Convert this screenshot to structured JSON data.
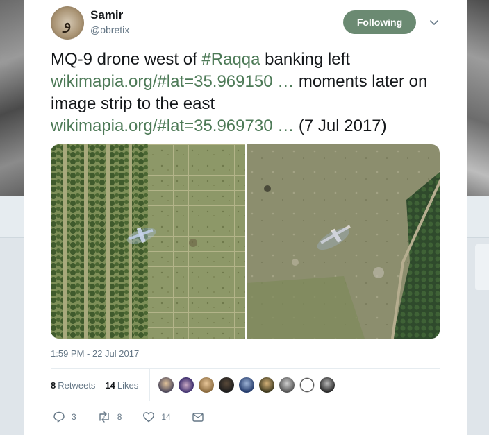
{
  "user": {
    "name": "Samir",
    "handle": "@obretix",
    "avatar_glyph": "و"
  },
  "follow_button": {
    "label": "Following"
  },
  "tweet": {
    "line1_pre": "MQ-9 drone west of ",
    "hashtag": "#Raqqa",
    "line1_post": " banking left",
    "link1": "wikimapia.org/#lat=35.969150 …",
    "mid_text": " moments later on image strip to the east",
    "link2": "wikimapia.org/#lat=35.969730 …",
    "tail_text": " (7 Jul 2017)"
  },
  "timestamp": "1:59 PM - 22 Jul 2017",
  "stats": {
    "retweets_count": "8",
    "retweets_label": "Retweets",
    "likes_count": "14",
    "likes_label": "Likes"
  },
  "actions": {
    "reply_count": "3",
    "retweet_count": "8",
    "like_count": "14"
  },
  "colors": {
    "accent": "#4d7a57",
    "follow_bg": "#6b8a72",
    "muted": "#657786"
  }
}
